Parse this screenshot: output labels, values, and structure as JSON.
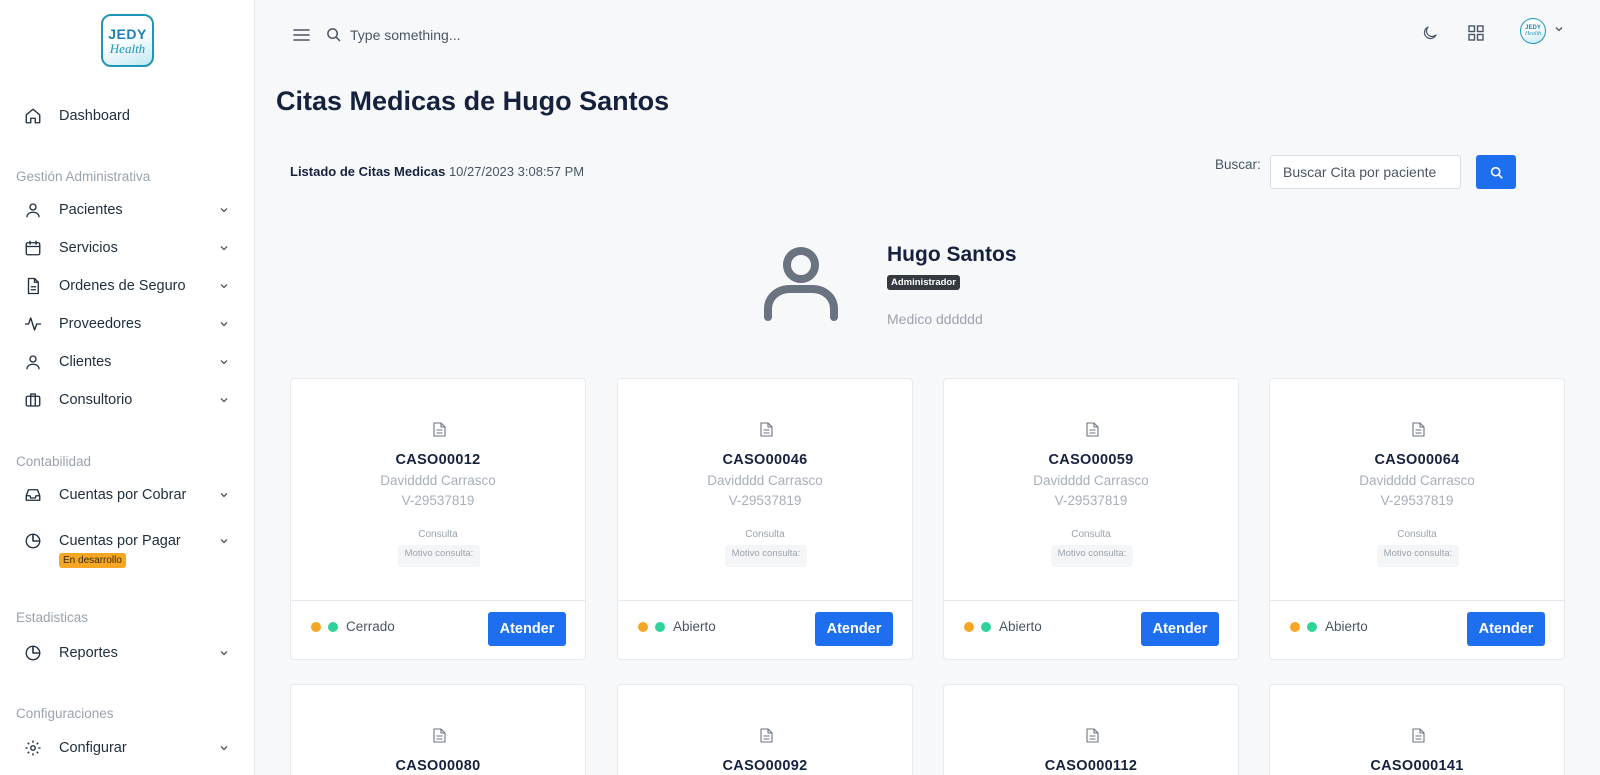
{
  "app": {
    "logo_line1": "JEDY",
    "logo_line2": "Health"
  },
  "sidebar": {
    "dashboard": "Dashboard",
    "sections": {
      "admin": "Gestión Administrativa",
      "contabilidad": "Contabilidad",
      "estadisticas": "Estadisticas",
      "config": "Configuraciones"
    },
    "items": {
      "pacientes": "Pacientes",
      "servicios": "Servicios",
      "ordenes": "Ordenes de Seguro",
      "proveedores": "Proveedores",
      "clientes": "Clientes",
      "consultorio": "Consultorio",
      "cobrar": "Cuentas por Cobrar",
      "pagar": "Cuentas por Pagar",
      "reportes": "Reportes",
      "configurar": "Configurar"
    },
    "dev_badge": "En desarrollo"
  },
  "topbar": {
    "search_placeholder": "Type something..."
  },
  "page": {
    "title": "Citas Medicas de Hugo Santos",
    "list_label": "Listado de Citas Medicas",
    "timestamp": "10/27/2023 3:08:57 PM",
    "buscar_label": "Buscar:",
    "buscar_placeholder": "Buscar Cita por paciente"
  },
  "profile": {
    "name": "Hugo Santos",
    "role": "Administrador",
    "description": "Medico dddddd"
  },
  "cards": [
    {
      "code": "CASO00012",
      "patient": "Davidddd Carrasco",
      "id": "V-29537819",
      "type": "Consulta",
      "motivo": "Motivo consulta:",
      "status": "Cerrado",
      "button": "Atender"
    },
    {
      "code": "CASO00046",
      "patient": "Davidddd Carrasco",
      "id": "V-29537819",
      "type": "Consulta",
      "motivo": "Motivo consulta:",
      "status": "Abierto",
      "button": "Atender"
    },
    {
      "code": "CASO00059",
      "patient": "Davidddd Carrasco",
      "id": "V-29537819",
      "type": "Consulta",
      "motivo": "Motivo consulta:",
      "status": "Abierto",
      "button": "Atender"
    },
    {
      "code": "CASO00064",
      "patient": "Davidddd Carrasco",
      "id": "V-29537819",
      "type": "Consulta",
      "motivo": "Motivo consulta:",
      "status": "Abierto",
      "button": "Atender"
    },
    {
      "code": "CASO00080"
    },
    {
      "code": "CASO00092"
    },
    {
      "code": "CASO000112"
    },
    {
      "code": "CASO000141"
    }
  ],
  "colors": {
    "primary": "#1e6ef0",
    "status_orange": "#f5a623",
    "status_green": "#2fd39a",
    "title": "#16213e"
  },
  "icons": [
    "home-icon",
    "user-icon",
    "calendar-icon",
    "document-icon",
    "activity-icon",
    "briefcase-icon",
    "inbox-icon",
    "pie-chart-icon",
    "gear-icon",
    "menu-icon",
    "search-icon",
    "moon-icon",
    "grid-icon",
    "chevron-down-icon"
  ]
}
